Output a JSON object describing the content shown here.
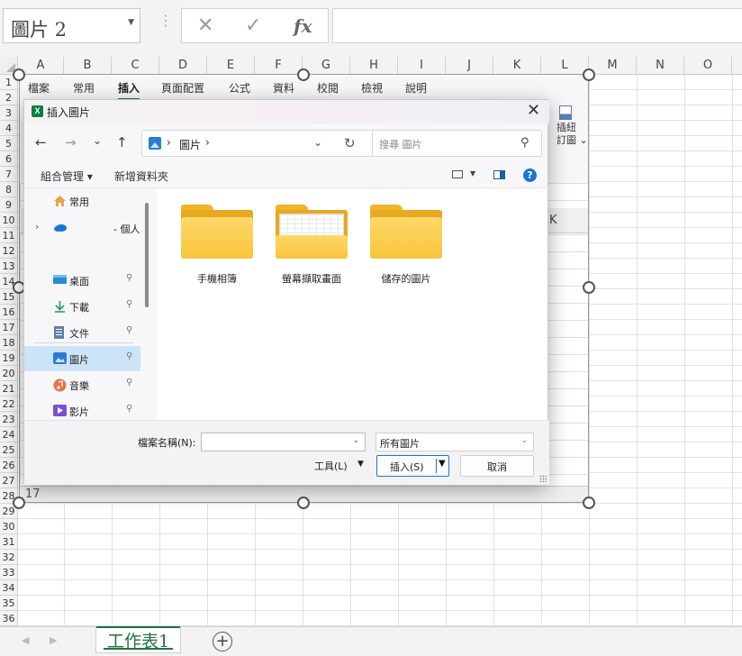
{
  "formula_bar": {
    "name_box": "圖片 2",
    "cancel_symbol": "✕",
    "enter_symbol": "✓",
    "fx_label": "fx",
    "formula": ""
  },
  "columns": [
    "A",
    "B",
    "C",
    "D",
    "E",
    "F",
    "G",
    "H",
    "I",
    "J",
    "K",
    "L",
    "M",
    "N",
    "O"
  ],
  "rows": [
    "1",
    "2",
    "3",
    "4",
    "5",
    "6",
    "7",
    "8",
    "9",
    "10",
    "11",
    "12",
    "13",
    "14",
    "15",
    "16",
    "17",
    "18",
    "19",
    "20",
    "21",
    "22",
    "23",
    "24",
    "25",
    "26",
    "27",
    "28",
    "29",
    "30",
    "31",
    "32",
    "33",
    "34",
    "35",
    "36"
  ],
  "picture": {
    "ribbon_tabs": [
      "檔案",
      "常用",
      "插入",
      "頁面配置",
      "公式",
      "資料",
      "校閱",
      "檢視",
      "說明"
    ],
    "active_tab": "插入",
    "ribbon_group_line1": "插紐",
    "ribbon_group_line2": "訂圖 ⌄",
    "inner_col_label": "K",
    "inner_row_label": "17"
  },
  "dialog": {
    "title": "插入圖片",
    "close": "✕",
    "nav": {
      "back": "←",
      "forward": "→",
      "recent": "⌄",
      "up": "↑"
    },
    "address_path": "圖片",
    "refresh": "↻",
    "search_placeholder": "搜尋 圖片",
    "toolbar": {
      "organize": "組合管理 ▾",
      "new_folder": "新增資料夾",
      "help": "?"
    },
    "nav_items": [
      {
        "label": "常用",
        "icon": "home-icon"
      },
      {
        "label": "- 個人",
        "icon": "onedrive-icon"
      },
      {
        "label": "桌面",
        "icon": "desktop-icon",
        "pinned": true
      },
      {
        "label": "下載",
        "icon": "download-icon",
        "pinned": true
      },
      {
        "label": "文件",
        "icon": "document-icon",
        "pinned": true
      },
      {
        "label": "圖片",
        "icon": "pictures-icon",
        "pinned": true,
        "selected": true
      },
      {
        "label": "音樂",
        "icon": "music-icon",
        "pinned": true
      },
      {
        "label": "影片",
        "icon": "video-icon",
        "pinned": true
      }
    ],
    "pin_symbol": "📌",
    "folders": [
      {
        "label": "手機相簿"
      },
      {
        "label": "螢幕擷取畫面"
      },
      {
        "label": "儲存的圖片"
      }
    ],
    "filename_label": "檔案名稱(N):",
    "filename_value": "",
    "filter_value": "所有圖片",
    "tools_label": "工具(L)",
    "insert_label": "插入(S)",
    "cancel_label": "取消"
  },
  "sheet_tabs": {
    "active": "工作表1",
    "add": "+"
  }
}
